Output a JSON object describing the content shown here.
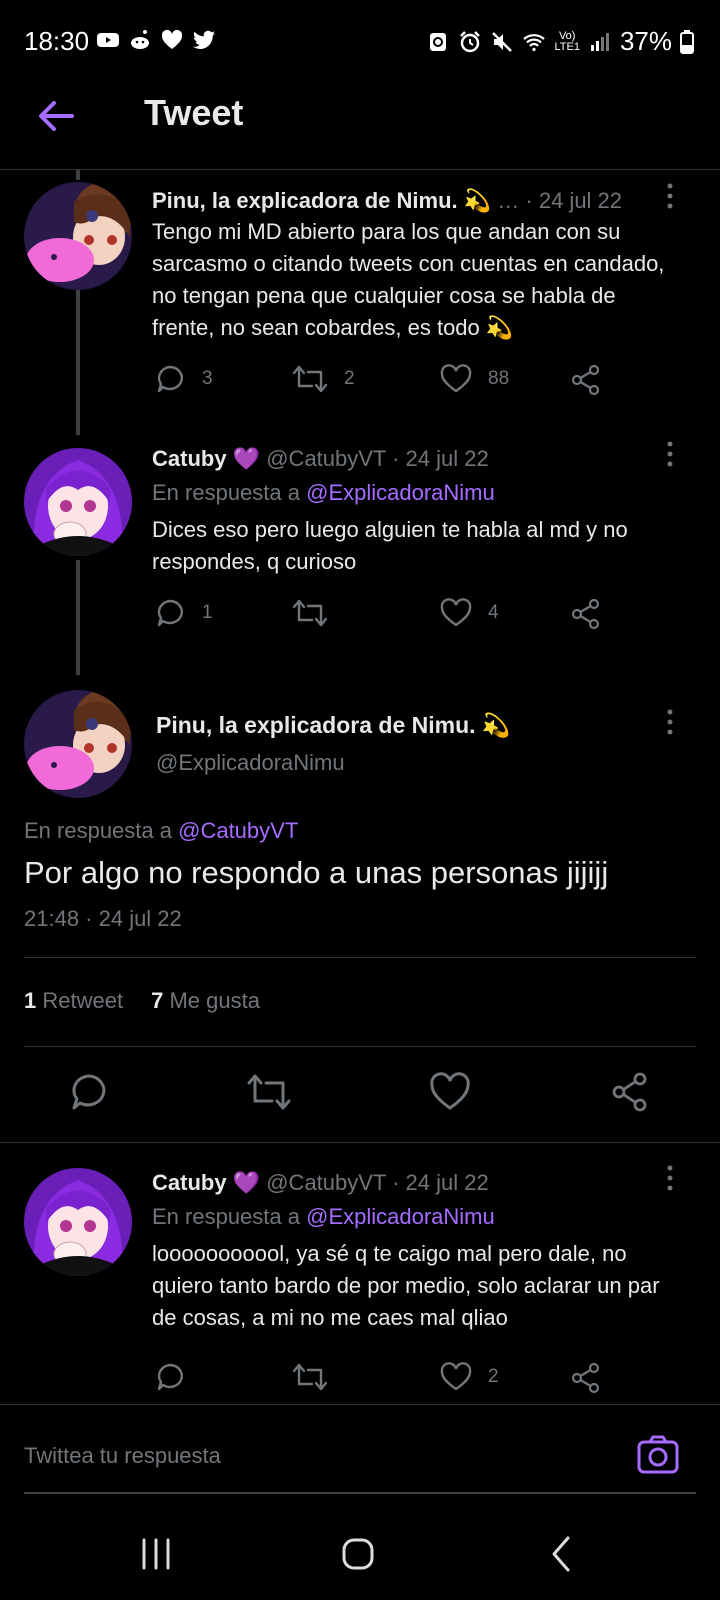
{
  "status_bar": {
    "time": "18:30",
    "battery": "37%",
    "network": "LTE1",
    "icons_left": [
      "youtube-icon",
      "reddit-icon",
      "heart-icon",
      "twitter-icon"
    ],
    "icons_right": [
      "nfc-icon",
      "alarm-icon",
      "mute-icon",
      "wifi-icon",
      "volte-icon",
      "signal-icon",
      "battery-icon"
    ]
  },
  "header": {
    "title": "Tweet"
  },
  "thread": [
    {
      "name": "Pinu, la explicadora de Nimu.",
      "emoji": "💫",
      "meta": "… · 24 jul 22",
      "text": "Tengo mi MD abierto para los que andan con su sarcasmo o citando tweets con cuentas en candado, no tengan pena que cualquier cosa se habla de frente, no sean cobardes, es todo 💫",
      "replies": "3",
      "retweets": "2",
      "likes": "88"
    },
    {
      "name": "Catuby",
      "emoji": "💜",
      "meta": "@CatubyVT · 24 jul 22",
      "reply_prefix": "En respuesta a ",
      "reply_to": "@ExplicadoraNimu",
      "text": "Dices eso pero luego alguien te habla al md y no respondes, q curioso",
      "replies": "1",
      "retweets": "",
      "likes": "4"
    }
  ],
  "focused": {
    "name": "Pinu, la explicadora de Nimu.",
    "emoji": "💫",
    "handle": "@ExplicadoraNimu",
    "reply_prefix": "En respuesta a ",
    "reply_to": "@CatubyVT",
    "text": "Por algo no respondo a unas personas jijijj",
    "timestamp": "21:48 · 24 jul 22",
    "retweet_count": "1",
    "retweet_label": "Retweet",
    "like_count": "7",
    "like_label": "Me gusta"
  },
  "reply": {
    "name": "Catuby",
    "emoji": "💜",
    "meta": "@CatubyVT · 24 jul 22",
    "reply_prefix": "En respuesta a ",
    "reply_to": "@ExplicadoraNimu",
    "text": "looooooooool, ya sé q te caigo mal pero dale, no quiero tanto bardo de por medio, solo aclarar un par de cosas, a mi no me caes mal qliao",
    "replies": "",
    "retweets": "",
    "likes": "2"
  },
  "composer": {
    "placeholder": "Twittea tu respuesta"
  },
  "colors": {
    "accent": "#a66bff",
    "muted": "#71767b",
    "background": "#000000"
  }
}
